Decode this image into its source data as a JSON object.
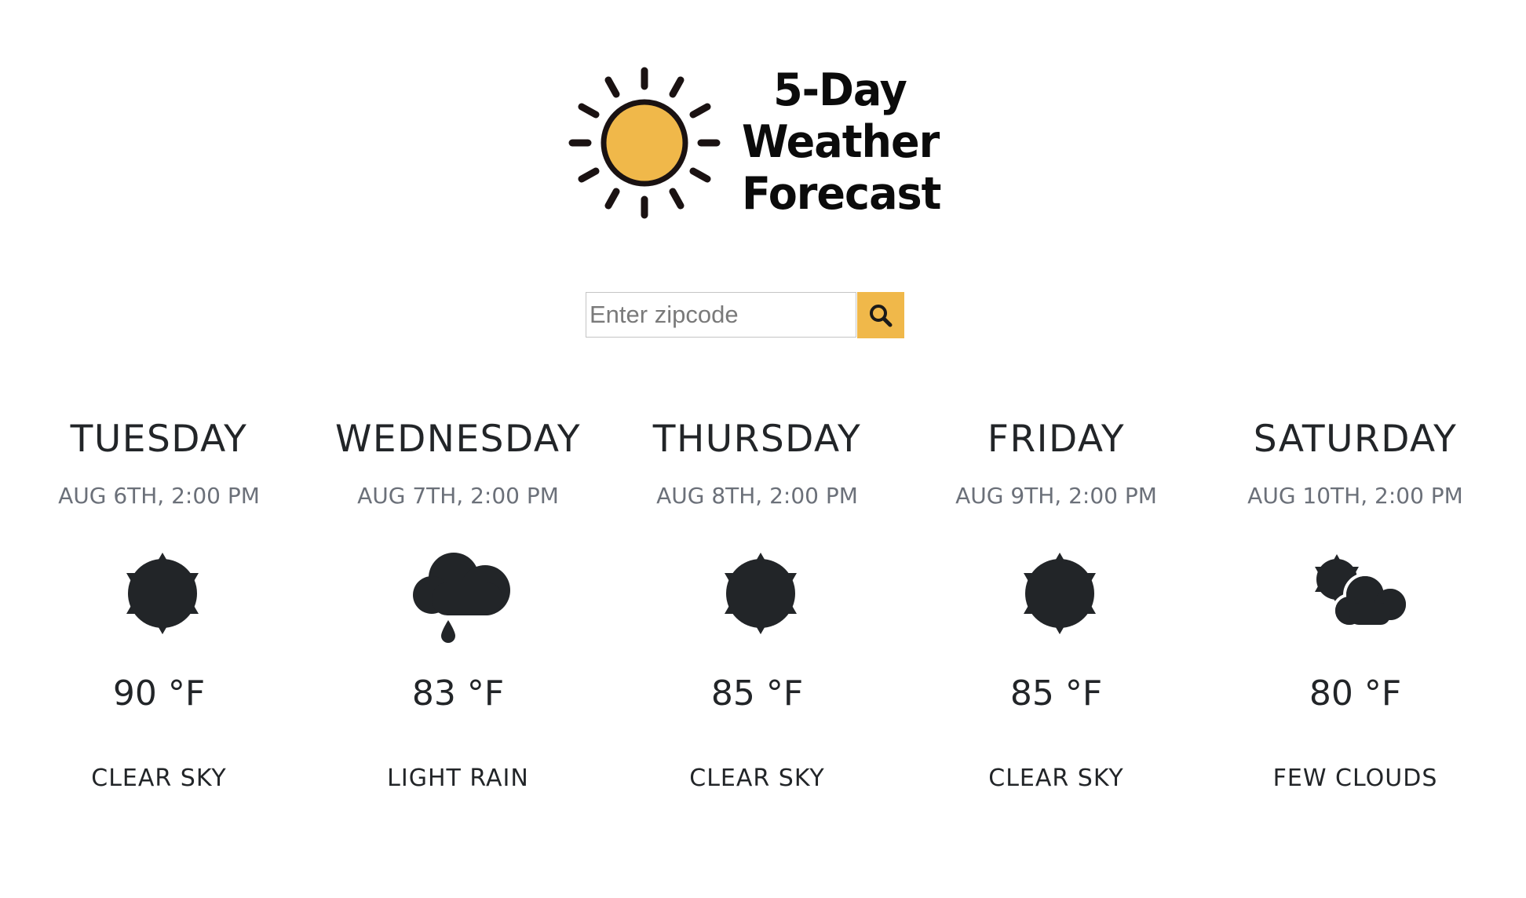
{
  "header": {
    "logo_lines": [
      "5-Day",
      "Weather",
      "Forecast"
    ],
    "logo_icon": "sun-icon"
  },
  "search": {
    "placeholder": "Enter zipcode",
    "value": "",
    "button_icon": "search-icon"
  },
  "colors": {
    "accent": "#f0b84a",
    "text": "#222528",
    "date_text": "#6b7079",
    "icon": "#222528"
  },
  "forecast": [
    {
      "day": "TUESDAY",
      "date": "AUG 6TH, 2:00 PM",
      "icon": "clear-sky-icon",
      "temp": "90 °F",
      "description": "CLEAR SKY"
    },
    {
      "day": "WEDNESDAY",
      "date": "AUG 7TH, 2:00 PM",
      "icon": "light-rain-icon",
      "temp": "83 °F",
      "description": "LIGHT RAIN"
    },
    {
      "day": "THURSDAY",
      "date": "AUG 8TH, 2:00 PM",
      "icon": "clear-sky-icon",
      "temp": "85 °F",
      "description": "CLEAR SKY"
    },
    {
      "day": "FRIDAY",
      "date": "AUG 9TH, 2:00 PM",
      "icon": "clear-sky-icon",
      "temp": "85 °F",
      "description": "CLEAR SKY"
    },
    {
      "day": "SATURDAY",
      "date": "AUG 10TH, 2:00 PM",
      "icon": "few-clouds-icon",
      "temp": "80 °F",
      "description": "FEW CLOUDS"
    }
  ]
}
